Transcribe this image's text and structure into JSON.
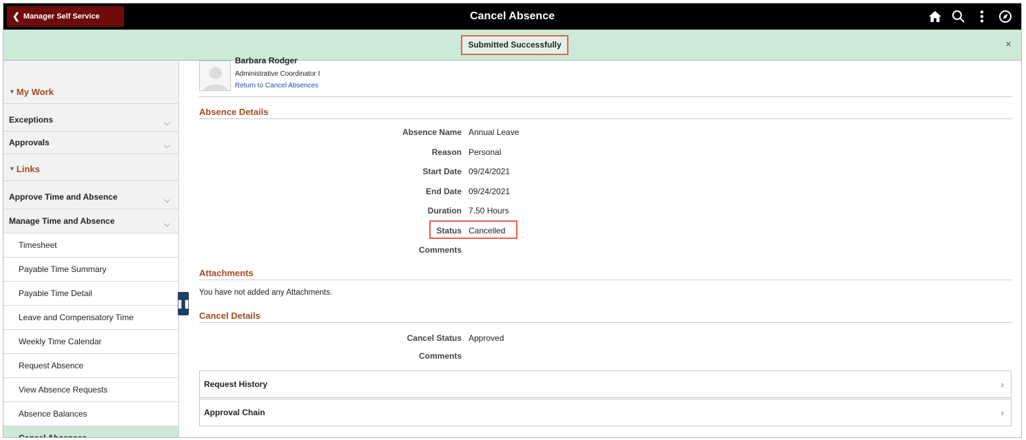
{
  "header": {
    "back_label": "Manager Self Service",
    "title": "Cancel Absence"
  },
  "banner": {
    "message": "Submitted Successfully",
    "close_label": "×"
  },
  "sidebar": {
    "my_work": "My Work",
    "exceptions": "Exceptions",
    "approvals": "Approvals",
    "links": "Links",
    "approve_time": "Approve Time and Absence",
    "manage_time": "Manage Time and Absence",
    "sub_items": [
      "Timesheet",
      "Payable Time Summary",
      "Payable Time Detail",
      "Leave and Compensatory Time",
      "Weekly Time Calendar",
      "Request Absence",
      "View Absence Requests",
      "Absence Balances",
      "Cancel Absences"
    ],
    "active_index": 8
  },
  "employee": {
    "name": "Barbara Rodger",
    "title": "Administrative Coordinator I",
    "return_link": "Return to Cancel Absences"
  },
  "absence_details": {
    "heading": "Absence Details",
    "rows": [
      {
        "label": "Absence Name",
        "value": "Annual Leave"
      },
      {
        "label": "Reason",
        "value": "Personal"
      },
      {
        "label": "Start Date",
        "value": "09/24/2021"
      },
      {
        "label": "End Date",
        "value": "09/24/2021"
      },
      {
        "label": "Duration",
        "value": "7.50 Hours"
      },
      {
        "label": "Status",
        "value": "Cancelled"
      },
      {
        "label": "Comments",
        "value": ""
      }
    ]
  },
  "attachments": {
    "heading": "Attachments",
    "message": "You have not added any Attachments."
  },
  "cancel_details": {
    "heading": "Cancel Details",
    "rows": [
      {
        "label": "Cancel Status",
        "value": "Approved"
      },
      {
        "label": "Comments",
        "value": ""
      }
    ]
  },
  "sections": {
    "request_history": "Request History",
    "approval_chain": "Approval Chain"
  },
  "icons": [
    "home-icon",
    "search-icon",
    "more-vert-icon",
    "compass-icon"
  ],
  "colors": {
    "topbar": "#000000",
    "back_button": "#6e0b0b",
    "banner": "#cde9d8",
    "section_title": "#a54a21",
    "highlight": "#e8604c",
    "link": "#2050b0"
  }
}
